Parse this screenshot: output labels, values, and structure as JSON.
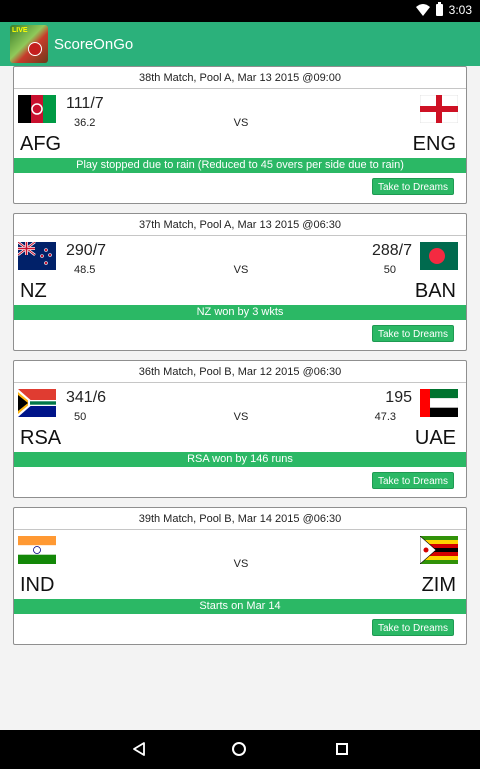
{
  "status_bar": {
    "time": "3:03",
    "icons": [
      "wifi-icon",
      "battery-icon"
    ]
  },
  "app_bar": {
    "title": "ScoreOnGo",
    "logo_text": "LIVE"
  },
  "colors": {
    "primary": "#2bb17b",
    "result_bar": "#2bb865"
  },
  "matches": [
    {
      "header": "38th Match, Pool A, Mar 13 2015 @09:00",
      "team1": {
        "abbr": "AFG",
        "score": "111/7",
        "overs": "36.2",
        "flag": "afghanistan-flag"
      },
      "team2": {
        "abbr": "ENG",
        "score": "",
        "overs": "",
        "flag": "england-flag"
      },
      "vs": "VS",
      "result": "Play stopped due to rain (Reduced to 45 overs per side due to rain)",
      "button": "Take to Dreams"
    },
    {
      "header": "37th Match, Pool A, Mar 13 2015 @06:30",
      "team1": {
        "abbr": "NZ",
        "score": "290/7",
        "overs": "48.5",
        "flag": "new-zealand-flag"
      },
      "team2": {
        "abbr": "BAN",
        "score": "288/7",
        "overs": "50",
        "flag": "bangladesh-flag"
      },
      "vs": "VS",
      "result": "NZ won by 3 wkts",
      "button": "Take to Dreams"
    },
    {
      "header": "36th Match, Pool B, Mar 12 2015 @06:30",
      "team1": {
        "abbr": "RSA",
        "score": "341/6",
        "overs": "50",
        "flag": "south-africa-flag"
      },
      "team2": {
        "abbr": "UAE",
        "score": "195",
        "overs": "47.3",
        "flag": "uae-flag"
      },
      "vs": "VS",
      "result": "RSA won by 146 runs",
      "button": "Take to Dreams"
    },
    {
      "header": "39th Match, Pool B, Mar 14 2015 @06:30",
      "team1": {
        "abbr": "IND",
        "score": "",
        "overs": "",
        "flag": "india-flag"
      },
      "team2": {
        "abbr": "ZIM",
        "score": "",
        "overs": "",
        "flag": "zimbabwe-flag"
      },
      "vs": "VS",
      "result": "Starts on Mar 14",
      "button": "Take to Dreams"
    }
  ],
  "nav_bar": {
    "buttons": [
      "back-icon",
      "home-icon",
      "recent-apps-icon"
    ]
  }
}
